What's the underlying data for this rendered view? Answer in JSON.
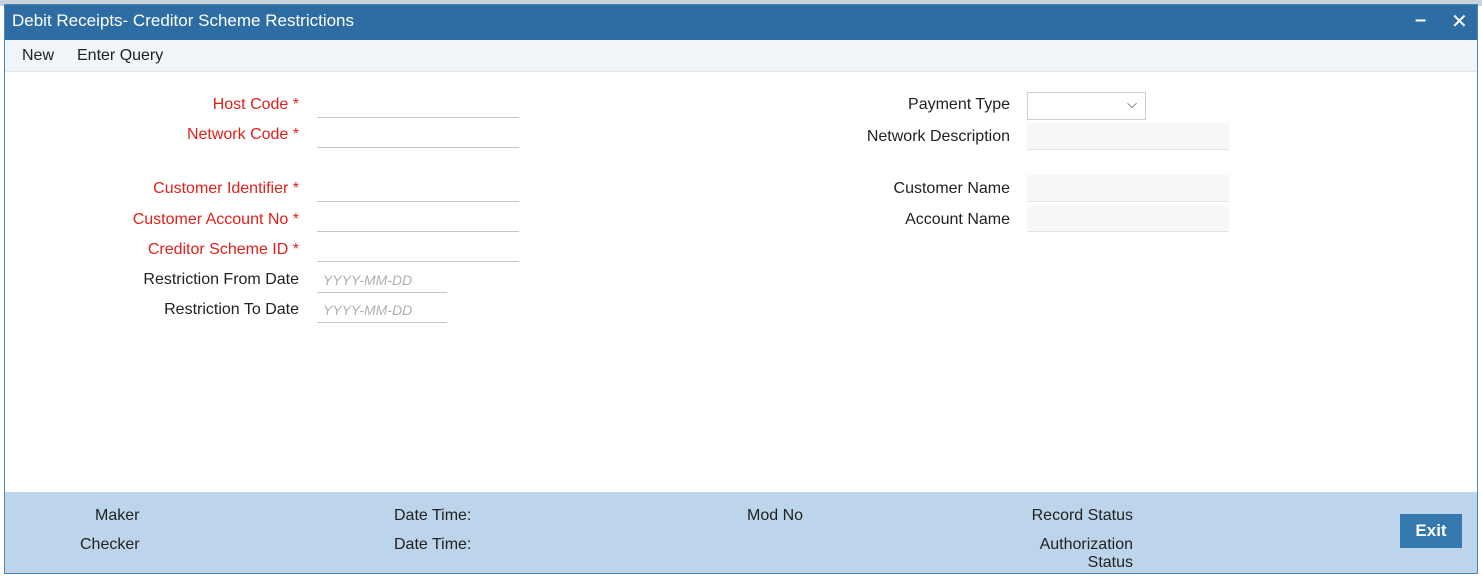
{
  "window": {
    "title": "Debit Receipts- Creditor Scheme Restrictions",
    "minimize_glyph": "–",
    "close_glyph": "✕"
  },
  "menu": {
    "new_label": "New",
    "enter_query_label": "Enter Query"
  },
  "form": {
    "host_code": {
      "label": "Host Code",
      "value": ""
    },
    "network_code": {
      "label": "Network Code",
      "value": ""
    },
    "customer_identifier": {
      "label": "Customer Identifier",
      "value": ""
    },
    "customer_account_no": {
      "label": "Customer Account No",
      "value": ""
    },
    "creditor_scheme_id": {
      "label": "Creditor Scheme ID",
      "value": ""
    },
    "restriction_from_date": {
      "label": "Restriction From Date",
      "placeholder": "YYYY-MM-DD"
    },
    "restriction_to_date": {
      "label": "Restriction To Date",
      "placeholder": "YYYY-MM-DD"
    },
    "required_marker": "*",
    "payment_type": {
      "label": "Payment Type",
      "value": ""
    },
    "network_description": {
      "label": "Network Description",
      "value": ""
    },
    "customer_name": {
      "label": "Customer Name",
      "value": ""
    },
    "account_name": {
      "label": "Account Name",
      "value": ""
    }
  },
  "footer": {
    "maker": "Maker",
    "checker": "Checker",
    "date_time_1": "Date Time:",
    "date_time_2": "Date Time:",
    "mod_no": "Mod No",
    "record_status": "Record Status",
    "authorization_status_line1": "Authorization",
    "authorization_status_line2": "Status",
    "exit_label": "Exit"
  },
  "colors": {
    "title_bar": "#2e6da4",
    "required_label": "#e0201b",
    "footer_bg": "#bcd5ea",
    "exit_button": "#3478ae"
  }
}
